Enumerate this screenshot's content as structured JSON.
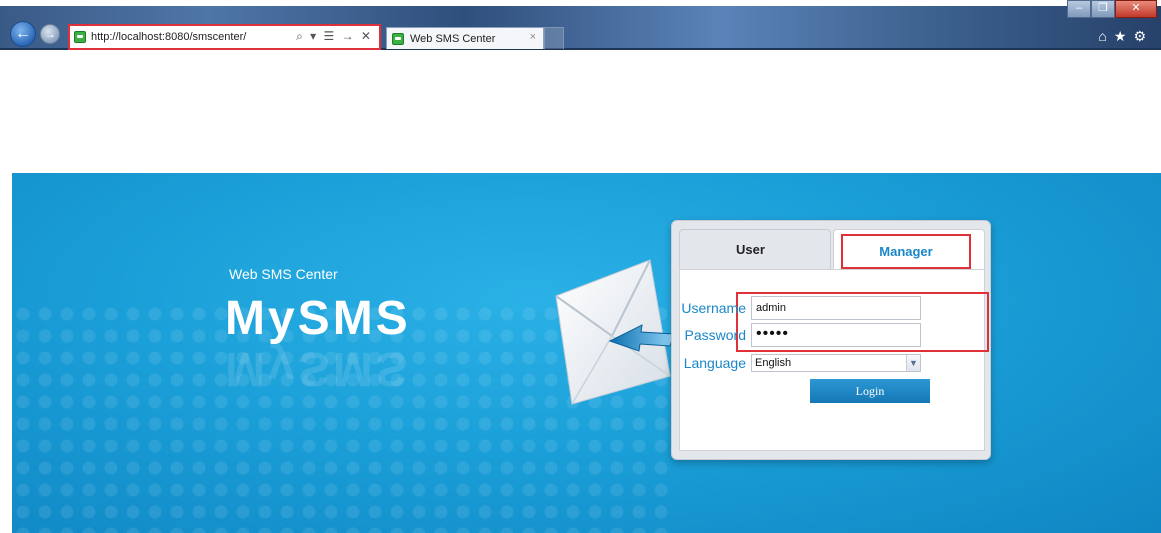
{
  "browser": {
    "url": "http://localhost:8080/smscenter/",
    "address_icons": "⌕ ▾ ☰ → ✕",
    "tab_title": "Web SMS Center",
    "tab_close": "×",
    "window_buttons": {
      "minimize": "–",
      "restore": "❐",
      "close": "✕"
    },
    "right_icons": {
      "home": "⌂",
      "favorites": "★",
      "tools": "⚙"
    },
    "back_icon": "←",
    "forward_icon": "→"
  },
  "banner": {
    "subtitle": "Web SMS Center",
    "brand": "MySMS"
  },
  "login": {
    "tabs": {
      "user": "User",
      "manager": "Manager"
    },
    "active_tab": "Manager",
    "username_label": "Username",
    "username_value": "admin",
    "password_label": "Password",
    "password_value": "•••••",
    "language_label": "Language",
    "language_value": "English",
    "button": "Login"
  },
  "colors": {
    "accent": "#1a87c9",
    "highlight": "#e0303a",
    "banner": "#1b9fd8"
  }
}
